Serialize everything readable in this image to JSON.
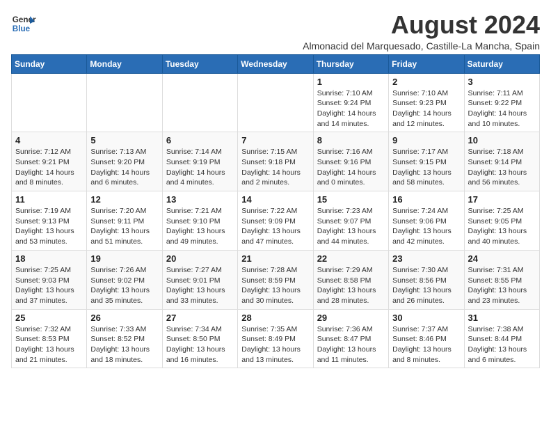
{
  "logo": {
    "line1": "General",
    "line2": "Blue"
  },
  "title": "August 2024",
  "location": "Almonacid del Marquesado, Castille-La Mancha, Spain",
  "headers": [
    "Sunday",
    "Monday",
    "Tuesday",
    "Wednesday",
    "Thursday",
    "Friday",
    "Saturday"
  ],
  "weeks": [
    [
      {
        "day": "",
        "info": ""
      },
      {
        "day": "",
        "info": ""
      },
      {
        "day": "",
        "info": ""
      },
      {
        "day": "",
        "info": ""
      },
      {
        "day": "1",
        "info": "Sunrise: 7:10 AM\nSunset: 9:24 PM\nDaylight: 14 hours and 14 minutes."
      },
      {
        "day": "2",
        "info": "Sunrise: 7:10 AM\nSunset: 9:23 PM\nDaylight: 14 hours and 12 minutes."
      },
      {
        "day": "3",
        "info": "Sunrise: 7:11 AM\nSunset: 9:22 PM\nDaylight: 14 hours and 10 minutes."
      }
    ],
    [
      {
        "day": "4",
        "info": "Sunrise: 7:12 AM\nSunset: 9:21 PM\nDaylight: 14 hours and 8 minutes."
      },
      {
        "day": "5",
        "info": "Sunrise: 7:13 AM\nSunset: 9:20 PM\nDaylight: 14 hours and 6 minutes."
      },
      {
        "day": "6",
        "info": "Sunrise: 7:14 AM\nSunset: 9:19 PM\nDaylight: 14 hours and 4 minutes."
      },
      {
        "day": "7",
        "info": "Sunrise: 7:15 AM\nSunset: 9:18 PM\nDaylight: 14 hours and 2 minutes."
      },
      {
        "day": "8",
        "info": "Sunrise: 7:16 AM\nSunset: 9:16 PM\nDaylight: 14 hours and 0 minutes."
      },
      {
        "day": "9",
        "info": "Sunrise: 7:17 AM\nSunset: 9:15 PM\nDaylight: 13 hours and 58 minutes."
      },
      {
        "day": "10",
        "info": "Sunrise: 7:18 AM\nSunset: 9:14 PM\nDaylight: 13 hours and 56 minutes."
      }
    ],
    [
      {
        "day": "11",
        "info": "Sunrise: 7:19 AM\nSunset: 9:13 PM\nDaylight: 13 hours and 53 minutes."
      },
      {
        "day": "12",
        "info": "Sunrise: 7:20 AM\nSunset: 9:11 PM\nDaylight: 13 hours and 51 minutes."
      },
      {
        "day": "13",
        "info": "Sunrise: 7:21 AM\nSunset: 9:10 PM\nDaylight: 13 hours and 49 minutes."
      },
      {
        "day": "14",
        "info": "Sunrise: 7:22 AM\nSunset: 9:09 PM\nDaylight: 13 hours and 47 minutes."
      },
      {
        "day": "15",
        "info": "Sunrise: 7:23 AM\nSunset: 9:07 PM\nDaylight: 13 hours and 44 minutes."
      },
      {
        "day": "16",
        "info": "Sunrise: 7:24 AM\nSunset: 9:06 PM\nDaylight: 13 hours and 42 minutes."
      },
      {
        "day": "17",
        "info": "Sunrise: 7:25 AM\nSunset: 9:05 PM\nDaylight: 13 hours and 40 minutes."
      }
    ],
    [
      {
        "day": "18",
        "info": "Sunrise: 7:25 AM\nSunset: 9:03 PM\nDaylight: 13 hours and 37 minutes."
      },
      {
        "day": "19",
        "info": "Sunrise: 7:26 AM\nSunset: 9:02 PM\nDaylight: 13 hours and 35 minutes."
      },
      {
        "day": "20",
        "info": "Sunrise: 7:27 AM\nSunset: 9:01 PM\nDaylight: 13 hours and 33 minutes."
      },
      {
        "day": "21",
        "info": "Sunrise: 7:28 AM\nSunset: 8:59 PM\nDaylight: 13 hours and 30 minutes."
      },
      {
        "day": "22",
        "info": "Sunrise: 7:29 AM\nSunset: 8:58 PM\nDaylight: 13 hours and 28 minutes."
      },
      {
        "day": "23",
        "info": "Sunrise: 7:30 AM\nSunset: 8:56 PM\nDaylight: 13 hours and 26 minutes."
      },
      {
        "day": "24",
        "info": "Sunrise: 7:31 AM\nSunset: 8:55 PM\nDaylight: 13 hours and 23 minutes."
      }
    ],
    [
      {
        "day": "25",
        "info": "Sunrise: 7:32 AM\nSunset: 8:53 PM\nDaylight: 13 hours and 21 minutes."
      },
      {
        "day": "26",
        "info": "Sunrise: 7:33 AM\nSunset: 8:52 PM\nDaylight: 13 hours and 18 minutes."
      },
      {
        "day": "27",
        "info": "Sunrise: 7:34 AM\nSunset: 8:50 PM\nDaylight: 13 hours and 16 minutes."
      },
      {
        "day": "28",
        "info": "Sunrise: 7:35 AM\nSunset: 8:49 PM\nDaylight: 13 hours and 13 minutes."
      },
      {
        "day": "29",
        "info": "Sunrise: 7:36 AM\nSunset: 8:47 PM\nDaylight: 13 hours and 11 minutes."
      },
      {
        "day": "30",
        "info": "Sunrise: 7:37 AM\nSunset: 8:46 PM\nDaylight: 13 hours and 8 minutes."
      },
      {
        "day": "31",
        "info": "Sunrise: 7:38 AM\nSunset: 8:44 PM\nDaylight: 13 hours and 6 minutes."
      }
    ]
  ]
}
